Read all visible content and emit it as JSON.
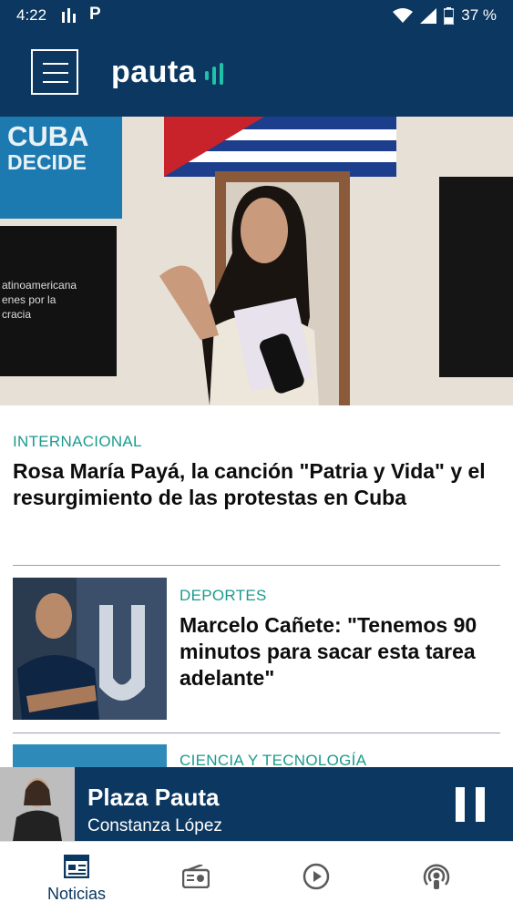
{
  "status_bar": {
    "time": "4:22",
    "carrier_glyph": "P",
    "battery": "37 %"
  },
  "app_bar": {
    "logo_text": "pauta"
  },
  "articles": [
    {
      "category": "INTERNACIONAL",
      "title": "Rosa María Payá, la canción \"Patria y Vida\" y el resurgimiento de las protestas en Cuba"
    },
    {
      "category": "DEPORTES",
      "title": "Marcelo Cañete: \"Tenemos 90 minutos para sacar esta tarea adelante\""
    },
    {
      "category": "CIENCIA Y TECNOLOGÍA",
      "title": ""
    }
  ],
  "hero_image": {
    "sign_line1": "CUBA",
    "sign_line2": "DECIDE",
    "poster_lines": [
      "atinoamericana",
      "enes por la",
      "cracia"
    ]
  },
  "player": {
    "title": "Plaza Pauta",
    "subtitle": "Constanza López"
  },
  "bottom_nav": [
    {
      "label": "Noticias",
      "icon": "newspaper-icon",
      "active": true
    },
    {
      "label": "",
      "icon": "radio-icon",
      "active": false
    },
    {
      "label": "",
      "icon": "play-circle-icon",
      "active": false
    },
    {
      "label": "",
      "icon": "podcast-icon",
      "active": false
    }
  ],
  "colors": {
    "primary": "#0b3760",
    "accent": "#1b9a8e",
    "text": "#0d0d0d"
  }
}
